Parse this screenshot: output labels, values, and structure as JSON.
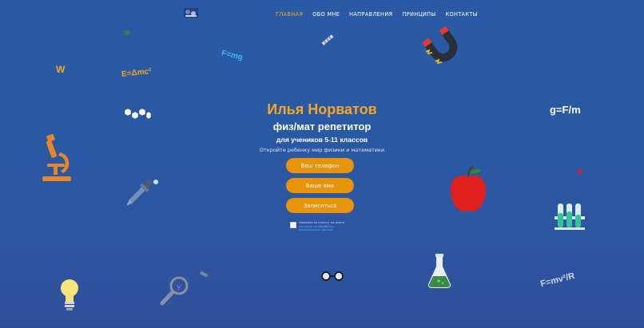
{
  "nav": {
    "items": [
      {
        "label": "ГЛАВНАЯ",
        "active": true
      },
      {
        "label": "ОБО МНЕ",
        "active": false
      },
      {
        "label": "НАПРАВЛЕНИЯ",
        "active": false
      },
      {
        "label": "ПРИНЦИПЫ",
        "active": false
      },
      {
        "label": "КОНТАКТЫ",
        "active": false
      }
    ]
  },
  "hero": {
    "title": "Илья Норватов",
    "subtitle": "физ/мат репетитор",
    "subtitle2": "для учеников 5-11 классов",
    "tagline": "Откройте ребенку мир физики и математики"
  },
  "form": {
    "phone_button": "Ваш телефон",
    "name_button": "Ваше имя",
    "submit_button": "Записаться",
    "consent_text": "Нажимая на кнопку, вы даете",
    "consent_link": "согласие на обработку персональных данных"
  },
  "formulas": {
    "w": "W",
    "emc": "E=Δmc²",
    "fmg": "F=mg",
    "gfm": "g=F/m",
    "fmv": "F=mv²/R"
  },
  "colors": {
    "accent": "#f5a623",
    "button": "#e8940a",
    "background": "#2a5aa5"
  },
  "icons": [
    "logo-icon",
    "molecule-icon",
    "magnet-icon",
    "hexagons-icon",
    "microscope-icon",
    "dropper-icon",
    "apple-icon",
    "test-tubes-icon",
    "lightbulb-icon",
    "magnifier-icon",
    "glasses-icon",
    "flask-icon"
  ]
}
